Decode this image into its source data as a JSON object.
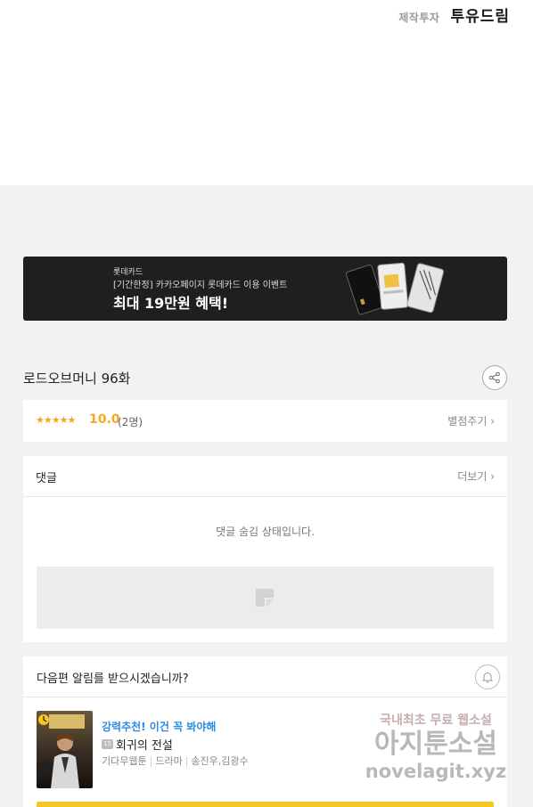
{
  "credit": {
    "label": "제작투자",
    "name": "투유드림"
  },
  "banner": {
    "brand": "롯데카드",
    "subtitle": "[기간한정] 카카오페이지 롯데카드 이용 이벤트",
    "title": "최대 19만원 혜택!"
  },
  "episode": {
    "title": "로드오브머니 96화"
  },
  "rating": {
    "stars": "★★★★★",
    "score": "10.0",
    "count": "(2명)",
    "rate_button": "별점주기 ›",
    "star_fill": 1.0
  },
  "comments": {
    "title": "댓글",
    "more": "더보기 ›",
    "hidden_message": "댓글 숨김 상태입니다."
  },
  "next": {
    "question": "다음편 알림를 받으시겠습니까?",
    "recommend_label": "강력추천! 이건 꼭 봐야해",
    "age_badge": "15",
    "work_title": "회귀의 전설",
    "category": "기다무웹툰",
    "genre": "드라마",
    "authors": "송진우,김광수"
  },
  "watermark": {
    "line1": "국내최초 무료 웹소설",
    "line2": "아지툰소설",
    "line3": "novelagit.xyz"
  },
  "colors": {
    "accent": "#f5a623",
    "link": "#2b8be0",
    "cta": "#f7c623",
    "banner_bg": "#1f1f1f"
  }
}
